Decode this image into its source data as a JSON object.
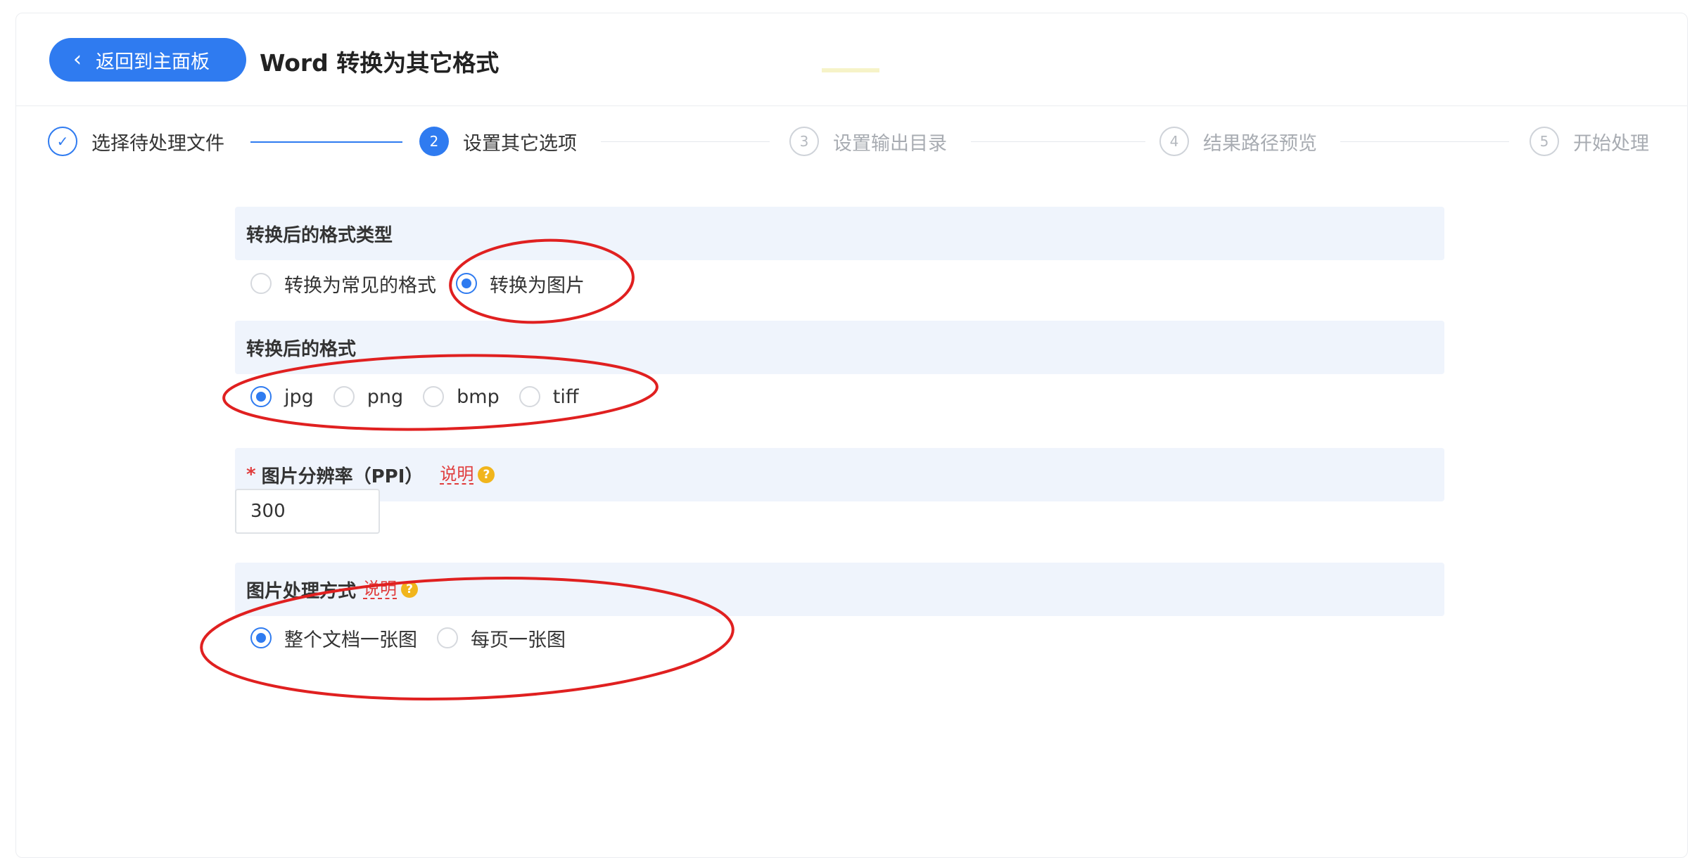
{
  "header": {
    "back_label": "返回到主面板",
    "title": "Word 转换为其它格式"
  },
  "steps": [
    {
      "index": "✓",
      "label": "选择待处理文件",
      "state": "done"
    },
    {
      "index": "2",
      "label": "设置其它选项",
      "state": "active"
    },
    {
      "index": "3",
      "label": "设置输出目录",
      "state": "todo"
    },
    {
      "index": "4",
      "label": "结果路径预览",
      "state": "todo"
    },
    {
      "index": "5",
      "label": "开始处理",
      "state": "todo"
    }
  ],
  "format_type": {
    "title": "转换后的格式类型",
    "options": [
      "转换为常见的格式",
      "转换为图片"
    ],
    "selected": "转换为图片"
  },
  "format": {
    "title": "转换后的格式",
    "options": [
      "jpg",
      "png",
      "bmp",
      "tiff"
    ],
    "selected": "jpg"
  },
  "resolution": {
    "required_mark": "*",
    "title": "图片分辨率（PPI）",
    "help": "说明",
    "help_icon": "?",
    "value": "300"
  },
  "processing": {
    "title": "图片处理方式",
    "help": "说明",
    "help_icon": "?",
    "options": [
      "整个文档一张图",
      "每页一张图"
    ],
    "selected": "整个文档一张图"
  },
  "colors": {
    "accent": "#2f7bf0",
    "annotation": "#e02020",
    "help": "#e03c3c"
  }
}
